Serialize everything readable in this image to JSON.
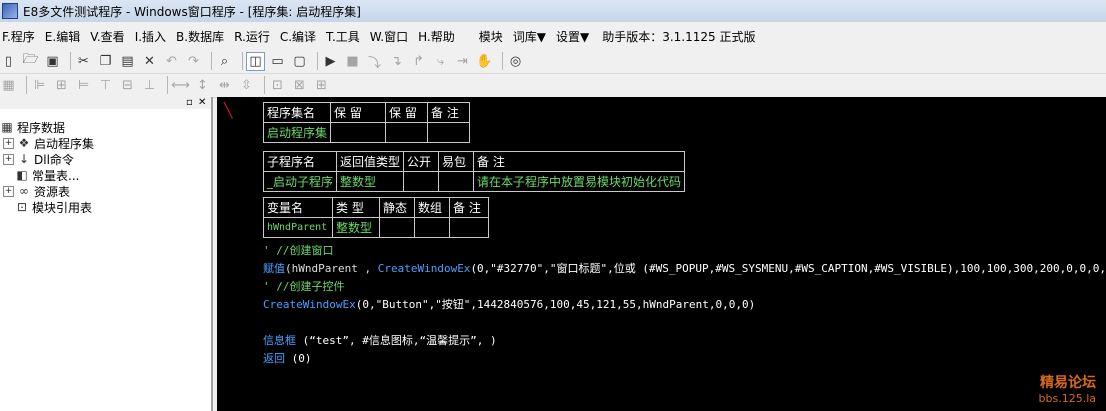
{
  "window": {
    "title": "E8多文件测试程序 - Windows窗口程序 - [程序集: 启动程序集]"
  },
  "menu": {
    "items": [
      "F.程序",
      "E.编辑",
      "V.查看",
      "I.插入",
      "B.数据库",
      "R.运行",
      "C.编译",
      "T.工具",
      "W.窗口",
      "H.帮助"
    ],
    "extra": [
      "模块",
      "词库▼",
      "设置▼"
    ],
    "version": "助手版本：3.1.1125 正式版"
  },
  "tree": {
    "root": "程序数据",
    "items": [
      "启动程序集",
      "Dll命令",
      "常量表...",
      "资源表",
      "模块引用表"
    ]
  },
  "editor": {
    "assembly_table": {
      "headers": [
        "程序集名",
        "保 留",
        "保 留",
        "备 注"
      ],
      "values": [
        "启动程序集",
        "",
        "",
        ""
      ]
    },
    "sub_table": {
      "headers": [
        "子程序名",
        "返回值类型",
        "公开",
        "易包",
        "备 注"
      ],
      "values": [
        "_启动子程序",
        "整数型",
        "",
        "",
        "请在本子程序中放置易模块初始化代码"
      ]
    },
    "var_table": {
      "headers": [
        "变量名",
        "类 型",
        "静态",
        "数组",
        "备 注"
      ],
      "values": [
        "hWndParent",
        "整数型",
        "",
        "",
        ""
      ]
    },
    "code": {
      "line1": "'  //创建窗口",
      "line2_kw": "赋值",
      "line2_rest": "(hWndParent , ",
      "line2_fn": "CreateWindowEx",
      "line2_args": "(0,\"#32770\",\"窗口标题\",位或 (#WS_POPUP,#WS_SYSMENU,#WS_CAPTION,#WS_VISIBLE),100,100,300,200,0,0,0,0))",
      "line3": "'  //创建子控件",
      "line4_fn": "CreateWindowEx",
      "line4_args": "(0,\"Button\",\"按钮\",1442840576,100,45,121,55,hWndParent,0,0,0)",
      "line5_kw": "信息框",
      "line5_args": " (“test”, #信息图标,“温馨提示”, )",
      "line6_kw": "返回",
      "line6_args": " (0)"
    }
  },
  "watermark": {
    "line1": "精易论坛",
    "line2": "bbs.125.la"
  }
}
